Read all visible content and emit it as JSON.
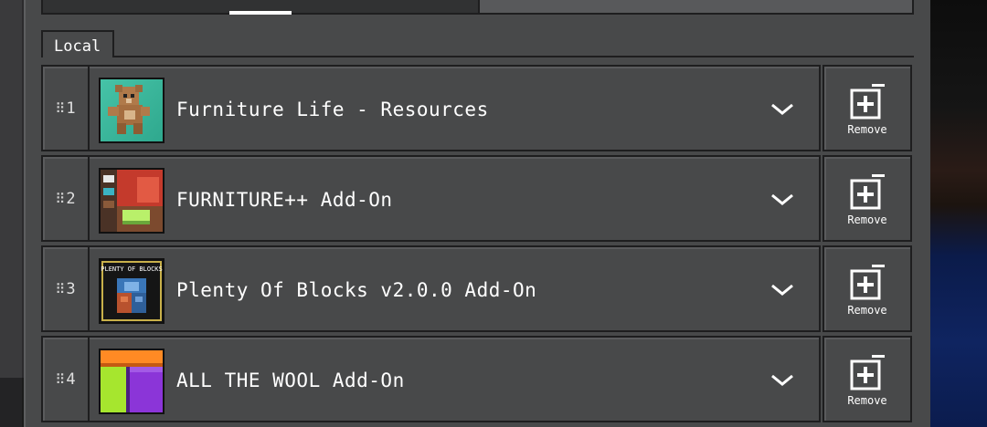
{
  "section": {
    "tab_label": "Local"
  },
  "packs": [
    {
      "index": "1",
      "name": "Furniture Life - Resources",
      "remove_label": "Remove",
      "icon": "teddy-bear-pack-icon"
    },
    {
      "index": "2",
      "name": "FURNITURE++ Add-On",
      "remove_label": "Remove",
      "icon": "furniture-room-pack-icon"
    },
    {
      "index": "3",
      "name": "Plenty Of Blocks v2.0.0 Add-On",
      "remove_label": "Remove",
      "icon": "plenty-of-blocks-pack-icon",
      "thumb_text": "PLENTY OF BLOCKS"
    },
    {
      "index": "4",
      "name": "ALL THE WOOL Add-On",
      "remove_label": "Remove",
      "icon": "wool-blocks-pack-icon"
    }
  ],
  "colors": {
    "panel": "#48494a",
    "border": "#1e1e1f",
    "text": "#ffffff"
  }
}
